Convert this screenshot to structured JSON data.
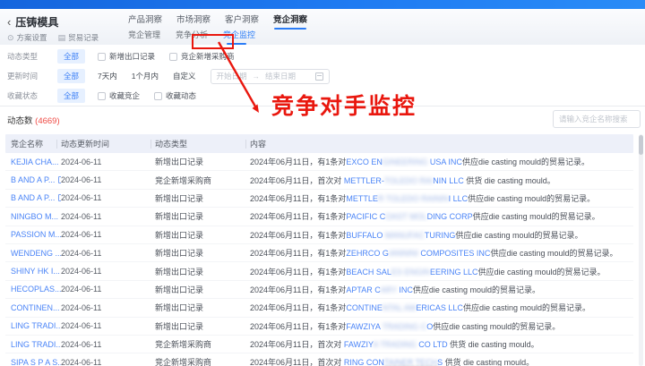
{
  "page": {
    "back_glyph": "‹",
    "title": "压铸模具"
  },
  "header": {
    "actions": {
      "plan": "方案设置",
      "records": "贸易记录"
    },
    "action_icons": {
      "settings": "⊙",
      "file": "▤"
    },
    "tabs": [
      "产品洞察",
      "市场洞察",
      "客户洞察",
      "竞企洞察"
    ],
    "active_tab": "竞企洞察",
    "subtabs": [
      "竞企管理",
      "竞争分析",
      "竞企监控"
    ],
    "active_subtab": "竞企监控"
  },
  "filters": {
    "type": {
      "label": "动态类型",
      "all": "全部",
      "cb1": "新增出口记录",
      "cb2": "竞企新增采购商"
    },
    "time": {
      "label": "更新时间",
      "all": "全部",
      "opt1": "7天内",
      "opt2": "1个月内",
      "opt3": "自定义",
      "start_placeholder": "开始日期",
      "range_arrow": "→",
      "end_placeholder": "结束日期"
    },
    "favorite": {
      "label": "收藏状态",
      "all": "全部",
      "cb1": "收藏竞企",
      "cb2": "收藏动态"
    }
  },
  "annotation": {
    "text": "竞争对手监控",
    "color": "#e9170e"
  },
  "stats": {
    "label": "动态数",
    "count": "(4669)",
    "count_color": "#ef4b45"
  },
  "search": {
    "placeholder": "请输入竞企名称搜索"
  },
  "accent_color": "#2b7cf6",
  "table": {
    "columns": [
      "竞企名称",
      "动态更新时间",
      "动态类型",
      "内容"
    ],
    "rows": [
      {
        "name": "KEJIA CHA...",
        "date": "2024-06-11",
        "type": "新增出口记录",
        "pre": "2024年06月11日，有1条对",
        "c1": "EXCO EN",
        "blur": "GINEERING ",
        "c2": "USA INC",
        "post": "供应die casting mould的贸易记录。"
      },
      {
        "name": "B AND A P...",
        "date": "2024-06-11",
        "type": "竞企新增采购商",
        "pre": "2024年06月11日，首次对 ",
        "c1": "METTLER-",
        "blur": "TOLEDO RAI",
        "c2": "NIN LLC",
        "post": " 供货 die casting mould。"
      },
      {
        "name": "B AND A P...",
        "date": "2024-06-11",
        "type": "新增出口记录",
        "pre": "2024年06月11日，有1条对",
        "c1": "METTLE",
        "blur": "R TOLEDO RAININ",
        "c2": "I LLC",
        "post": "供应die casting mould的贸易记录。"
      },
      {
        "name": "NINGBO M...",
        "date": "2024-06-11",
        "type": "新增出口记录",
        "pre": "2024年06月11日，有1条对",
        "c1": "PACIFIC C",
        "blur": "OAST MOL",
        "c2": "DING CORP",
        "post": "供应die casting mould的贸易记录。"
      },
      {
        "name": "PASSION M...",
        "date": "2024-06-11",
        "type": "新增出口记录",
        "pre": "2024年06月11日，有1条对",
        "c1": "BUFFALO",
        "blur": " MANUFAC",
        "c2": "TURING",
        "post": "供应die casting mould的贸易记录。"
      },
      {
        "name": "WENDENG ...",
        "date": "2024-06-11",
        "type": "新增出口记录",
        "pre": "2024年06月11日，有1条对",
        "c1": "ZEHRCO G",
        "blur": "IANNINI ",
        "c2": "COMPOSITES INC",
        "post": "供应die casting mould的贸易记录。"
      },
      {
        "name": "SHINY HK I...",
        "date": "2024-06-11",
        "type": "新增出口记录",
        "pre": "2024年06月11日，有1条对",
        "c1": "BEACH SAL",
        "blur": "ES ENGIN",
        "c2": "EERING LLC",
        "post": "供应die casting mould的贸易记录。"
      },
      {
        "name": "HECOPLAS...",
        "date": "2024-06-11",
        "type": "新增出口记录",
        "pre": "2024年06月11日，有1条对",
        "c1": "APTAR C",
        "blur": "ARY ",
        "c2": "INC",
        "post": "供应die casting mould的贸易记录。"
      },
      {
        "name": "CONTINEN...",
        "date": "2024-06-11",
        "type": "新增出口记录",
        "pre": "2024年06月11日，有1条对",
        "c1": "CONTINE",
        "blur": "NTAL AM",
        "c2": "ERICAS LLC",
        "post": "供应die casting mould的贸易记录。"
      },
      {
        "name": "LING TRADI...",
        "date": "2024-06-11",
        "type": "新增出口记录",
        "pre": "2024年06月11日，有1条对",
        "c1": "FAWZIYA",
        "blur": " TRADING C",
        "c2": "O",
        "post": "供应die casting mould的贸易记录。"
      },
      {
        "name": "LING TRADI...",
        "date": "2024-06-11",
        "type": "竞企新增采购商",
        "pre": "2024年06月11日，首次对 ",
        "c1": "FAWZIY",
        "blur": "A TRADING ",
        "c2": "CO LTD",
        "post": " 供货 die casting mould。"
      },
      {
        "name": "SIPA S P A S...",
        "date": "2024-06-11",
        "type": "竞企新增采购商",
        "pre": "2024年06月11日，首次对 ",
        "c1": "RING CON",
        "blur": "TAINER TECH",
        "c2": "S",
        "post": " 供货 die casting mould。",
        "dashed": true
      }
    ]
  }
}
